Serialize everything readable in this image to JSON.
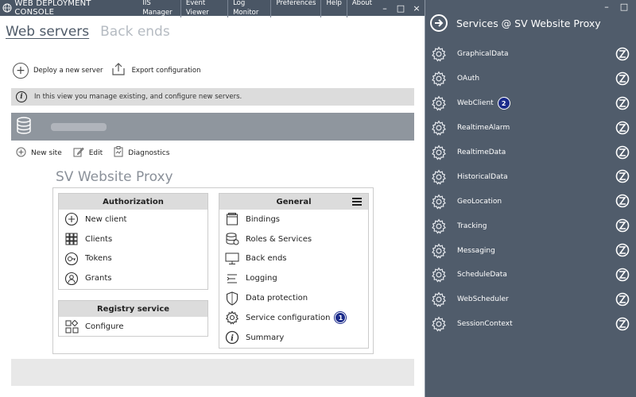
{
  "window": {
    "title": "WEB DEPLOYMENT CONSOLE",
    "menu": [
      "IIS Manager",
      "Event Viewer",
      "Log Monitor",
      "Preferences",
      "Help",
      "About"
    ],
    "controls": [
      "–",
      "□",
      "×"
    ]
  },
  "tabs": [
    {
      "label": "Web servers",
      "active": true
    },
    {
      "label": "Back ends",
      "active": false
    }
  ],
  "actions": {
    "deploy_label": "Deploy a new server",
    "export_label": "Export configuration"
  },
  "info": {
    "text": "In this view you manage existing, and configure new servers."
  },
  "server": {
    "name": ""
  },
  "site_actions": {
    "new_site": "New site",
    "edit": "Edit",
    "diagnostics": "Diagnostics"
  },
  "site": {
    "title": "SV Website Proxy"
  },
  "authorization": {
    "title": "Authorization",
    "items": [
      {
        "label": "New client",
        "icon": "plus-circle-icon"
      },
      {
        "label": "Clients",
        "icon": "grid-icon"
      },
      {
        "label": "Tokens",
        "icon": "token-icon"
      },
      {
        "label": "Grants",
        "icon": "grants-icon"
      }
    ]
  },
  "registry": {
    "title": "Registry service",
    "items": [
      {
        "label": "Configure",
        "icon": "configure-icon"
      }
    ]
  },
  "general": {
    "title": "General",
    "items": [
      {
        "label": "Bindings",
        "icon": "bindings-icon"
      },
      {
        "label": "Roles & Services",
        "icon": "database-icon"
      },
      {
        "label": "Back ends",
        "icon": "monitor-icon"
      },
      {
        "label": "Logging",
        "icon": "logging-icon"
      },
      {
        "label": "Data protection",
        "icon": "shield-icon"
      },
      {
        "label": "Service configuration",
        "icon": "gear-icon",
        "badge": "1"
      },
      {
        "label": "Summary",
        "icon": "info-icon"
      }
    ]
  },
  "flyout": {
    "title": "Services @ SV Website Proxy",
    "controls": [
      "–",
      "□"
    ],
    "services": [
      {
        "label": "GraphicalData"
      },
      {
        "label": "OAuth"
      },
      {
        "label": "WebClient",
        "badge": "2"
      },
      {
        "label": "RealtimeAlarm"
      },
      {
        "label": "RealtimeData"
      },
      {
        "label": "HistoricalData"
      },
      {
        "label": "GeoLocation"
      },
      {
        "label": "Tracking"
      },
      {
        "label": "Messaging"
      },
      {
        "label": "ScheduleData"
      },
      {
        "label": "WebScheduler"
      },
      {
        "label": "SessionContext"
      }
    ]
  },
  "colors": {
    "titlebar": "#4a5665",
    "flyout_bg": "#505c6b",
    "server_bar": "#8f969e",
    "badge": "#1b2b8a"
  }
}
